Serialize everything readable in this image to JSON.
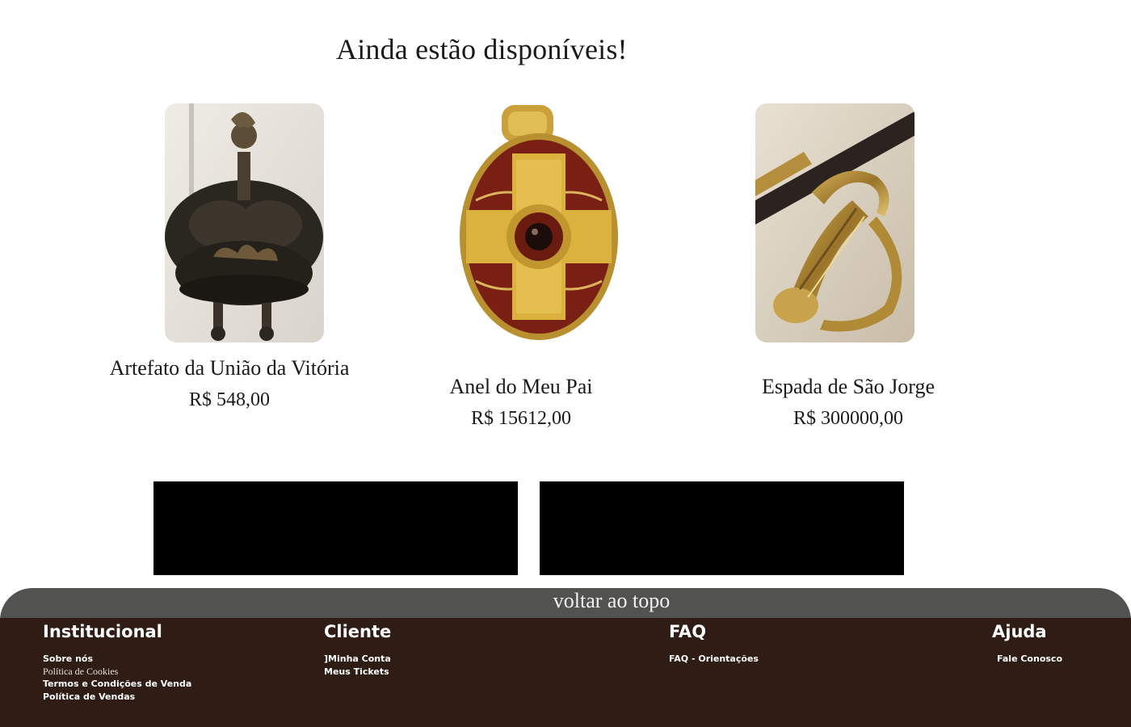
{
  "section": {
    "title": "Ainda estão disponíveis!"
  },
  "products": [
    {
      "name": "Artefato da União da Vitória",
      "price": "R$ 548,00",
      "image": "bronze-vessel-image"
    },
    {
      "name": "Anel do Meu Pai",
      "price": "R$ 15612,00",
      "image": "gold-garnet-pendant-image"
    },
    {
      "name": "Espada de São Jorge",
      "price": "R$ 300000,00",
      "image": "ornate-sword-hilt-image"
    }
  ],
  "back_to_top": {
    "label": "voltar ao topo"
  },
  "footer": {
    "institucional": {
      "title": "Institucional",
      "links": [
        "Sobre nós",
        "Política de Cookies",
        "Termos e Condições de Venda",
        "Política de Vendas"
      ]
    },
    "cliente": {
      "title": "Cliente",
      "links": [
        "]Minha Conta",
        "Meus Tickets"
      ]
    },
    "faq": {
      "title": "FAQ",
      "links": [
        "FAQ - Orientações"
      ]
    },
    "ajuda": {
      "title": "Ajuda",
      "links": [
        "Fale Conosco"
      ]
    }
  },
  "colors": {
    "footer_bg": "#2f1c14",
    "back_to_top_bg": "#525251",
    "banner_bg": "#000000"
  }
}
